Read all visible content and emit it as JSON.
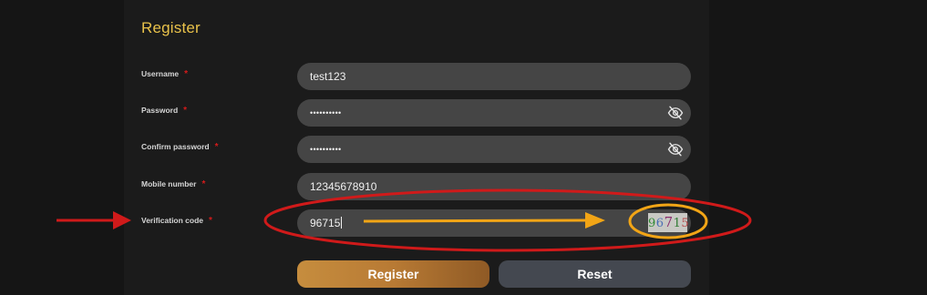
{
  "form": {
    "title": "Register",
    "required_mark": "*",
    "fields": [
      {
        "label": "Username",
        "value": "test123"
      },
      {
        "label": "Password",
        "value": "••••••••••",
        "icon": "eye-off-icon"
      },
      {
        "label": "Confirm password",
        "value": "••••••••••",
        "icon": "eye-off-icon"
      },
      {
        "label": "Mobile number",
        "value": "12345678910"
      },
      {
        "label": "Verification code",
        "value": "96715"
      }
    ],
    "captcha": [
      "9",
      "6",
      "7",
      "1",
      "5"
    ]
  },
  "buttons": {
    "register_label": "Register",
    "reset_label": "Reset"
  },
  "colors": {
    "title": "#e9c24a",
    "required": "#d41b1b",
    "annotation_red": "#d01a1a",
    "annotation_orange": "#f2a516"
  }
}
